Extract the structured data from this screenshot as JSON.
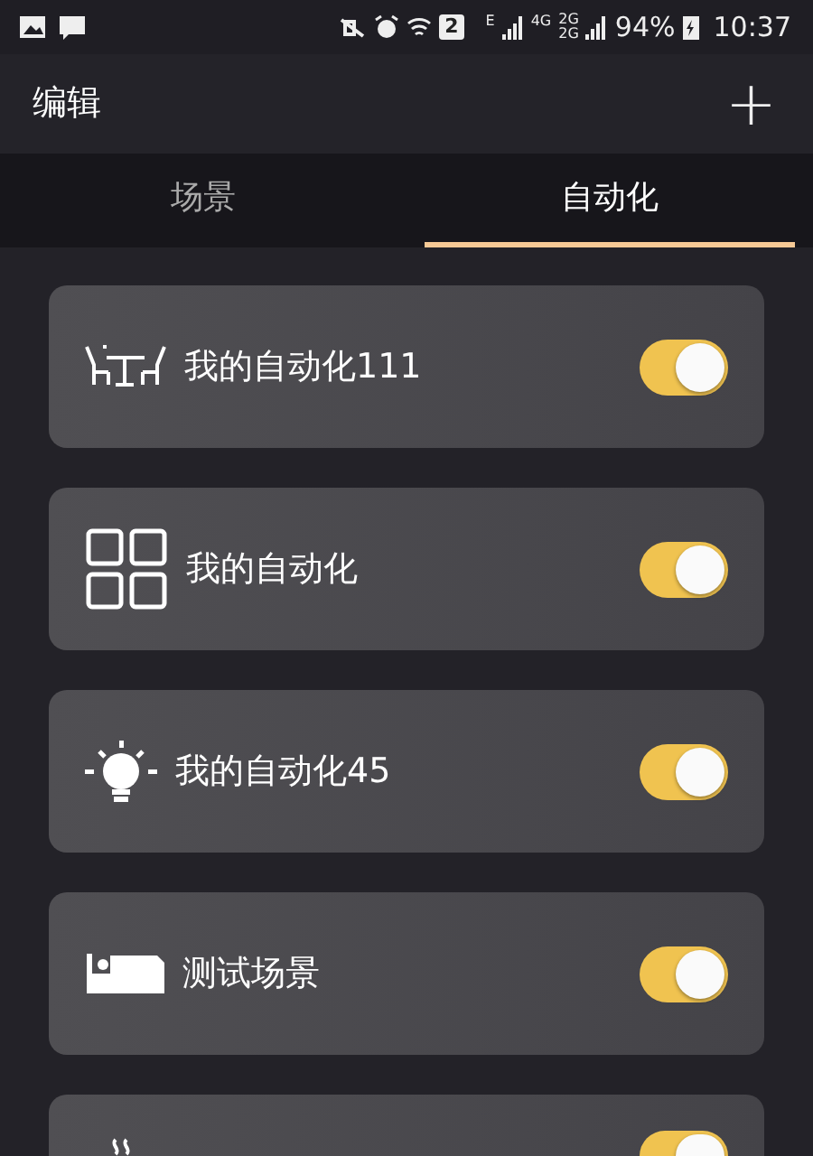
{
  "status_bar": {
    "sim_slot": "2",
    "data_type": "E",
    "network": "4G",
    "network_labels": [
      "2G",
      "2G"
    ],
    "battery": "94%",
    "time": "10:37"
  },
  "header": {
    "title": "编辑",
    "add_button": "+"
  },
  "tabs": [
    {
      "label": "场景",
      "selected": false
    },
    {
      "label": "自动化",
      "selected": true
    }
  ],
  "automations": [
    {
      "kind": "table",
      "label": "我的自动化111",
      "on": true
    },
    {
      "kind": "grid",
      "label": "我的自动化",
      "on": true
    },
    {
      "kind": "bulb",
      "label": "我的自动化45",
      "on": true
    },
    {
      "kind": "bed",
      "label": "测试场景",
      "on": true
    },
    {
      "kind": "steam",
      "on": true
    }
  ]
}
